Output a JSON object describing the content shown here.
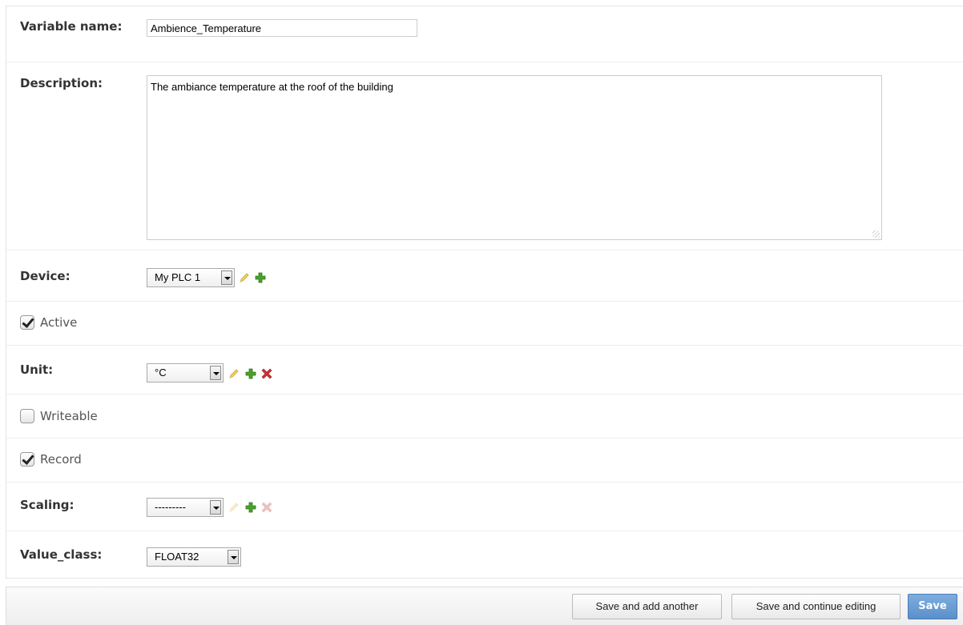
{
  "form": {
    "variable_name": {
      "label": "Variable name:",
      "value": "Ambience_Temperature"
    },
    "description": {
      "label": "Description:",
      "value": "The ambiance temperature at the roof of the building"
    },
    "device": {
      "label": "Device:",
      "selected": "My PLC 1"
    },
    "active": {
      "label": "Active",
      "checked": true
    },
    "unit": {
      "label": "Unit:",
      "selected": "°C"
    },
    "writeable": {
      "label": "Writeable",
      "checked": false
    },
    "record": {
      "label": "Record",
      "checked": true
    },
    "scaling": {
      "label": "Scaling:",
      "selected": "---------"
    },
    "value_class": {
      "label": "Value_class:",
      "selected": "FLOAT32"
    }
  },
  "icons": {
    "edit": "pencil-icon",
    "add": "plus-icon",
    "delete": "x-icon"
  },
  "colors": {
    "add_green": "#4aa02c",
    "delete_red": "#cc3333",
    "save_blue": "#6b9bd2"
  },
  "footer": {
    "save_add_another": "Save and add another",
    "save_continue": "Save and continue editing",
    "save": "Save"
  }
}
